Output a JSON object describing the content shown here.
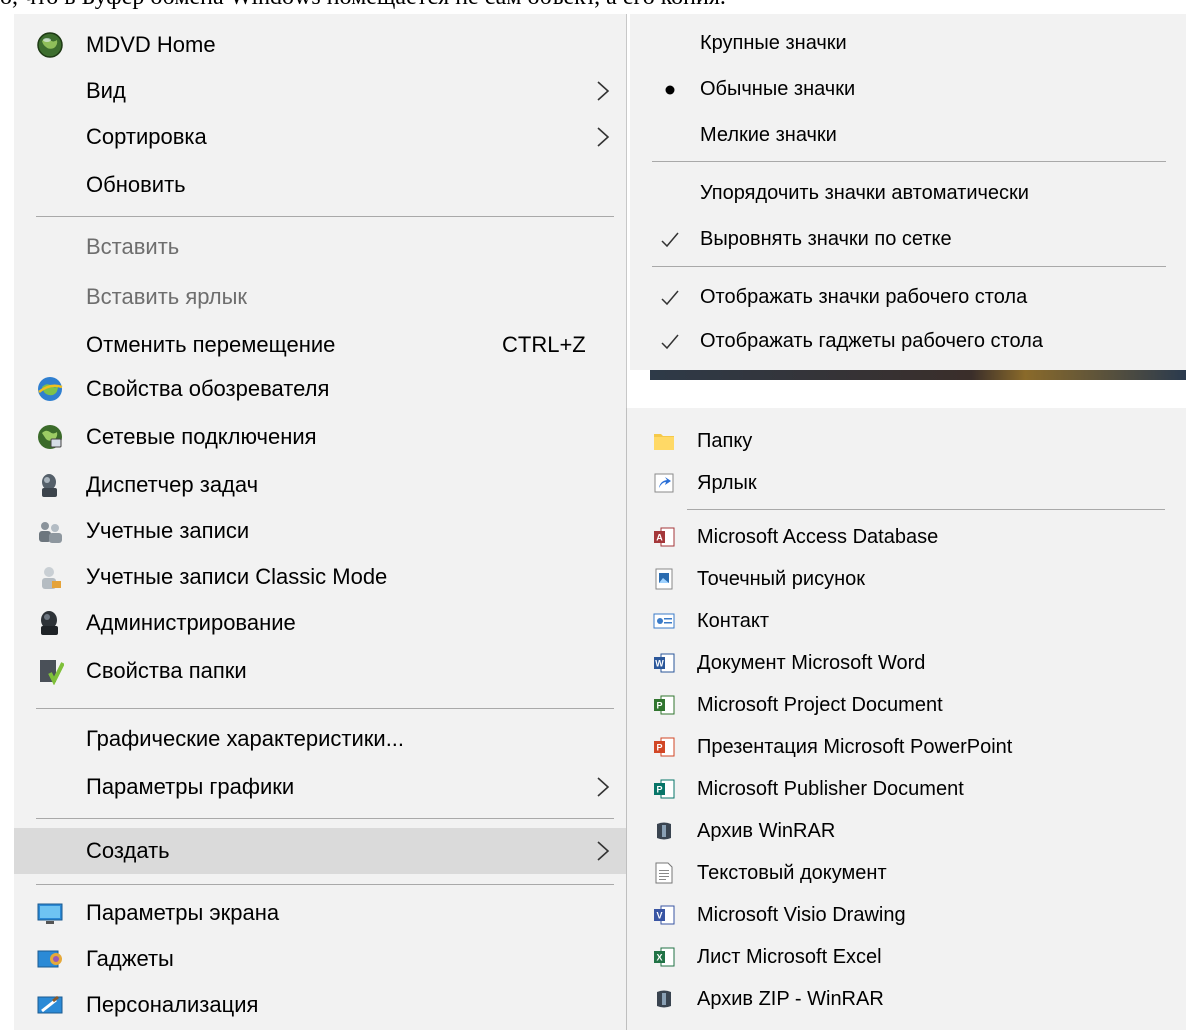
{
  "document": {
    "header_text": "о, что в Буфер обмена Windows помещается не сам объект, а его копия."
  },
  "main_menu": {
    "items": [
      {
        "label": "MDVD Home",
        "icon": "globe-icon"
      },
      {
        "label": "Вид",
        "submenu": true
      },
      {
        "label": "Сортировка",
        "submenu": true
      },
      {
        "label": "Обновить"
      },
      {
        "label": "Вставить",
        "disabled": true
      },
      {
        "label": "Вставить ярлык",
        "disabled": true
      },
      {
        "label": "Отменить перемещение",
        "shortcut": "CTRL+Z"
      },
      {
        "label": "Свойства обозревателя",
        "icon": "internet-options-icon"
      },
      {
        "label": "Сетевые подключения",
        "icon": "network-connections-icon"
      },
      {
        "label": "Диспетчер задач",
        "icon": "task-manager-icon"
      },
      {
        "label": "Учетные записи",
        "icon": "user-accounts-icon"
      },
      {
        "label": "Учетные записи Classic Mode",
        "icon": "user-accounts-classic-icon"
      },
      {
        "label": "Администрирование",
        "icon": "administration-icon"
      },
      {
        "label": "Свойства папки",
        "icon": "folder-options-icon"
      },
      {
        "label": "Графические характеристики..."
      },
      {
        "label": "Параметры графики",
        "submenu": true
      },
      {
        "label": "Создать",
        "submenu": true,
        "highlighted": true
      },
      {
        "label": "Параметры экрана",
        "icon": "display-settings-icon"
      },
      {
        "label": "Гаджеты",
        "icon": "gadgets-icon"
      },
      {
        "label": "Персонализация",
        "icon": "personalization-icon"
      }
    ]
  },
  "view_menu": {
    "items": [
      {
        "label": "Крупные значки"
      },
      {
        "label": "Обычные значки",
        "mark": "bullet"
      },
      {
        "label": "Мелкие значки"
      },
      {
        "label": "Упорядочить значки автоматически"
      },
      {
        "label": "Выровнять значки по сетке",
        "mark": "check"
      },
      {
        "label": "Отображать значки рабочего стола",
        "mark": "check"
      },
      {
        "label": "Отображать гаджеты  рабочего стола",
        "mark": "check"
      }
    ]
  },
  "new_menu": {
    "items": [
      {
        "label": "Папку",
        "icon": "folder-icon"
      },
      {
        "label": "Ярлык",
        "icon": "shortcut-icon"
      },
      {
        "label": "Microsoft Access Database",
        "icon": "access-icon",
        "color": "#a4373a"
      },
      {
        "label": "Точечный рисунок",
        "icon": "bitmap-icon",
        "color": "#2b6cb0"
      },
      {
        "label": "Контакт",
        "icon": "contact-icon",
        "color": "#3a7bc8"
      },
      {
        "label": "Документ Microsoft Word",
        "icon": "word-icon",
        "color": "#2b579a"
      },
      {
        "label": "Microsoft Project Document",
        "icon": "project-icon",
        "color": "#31752f"
      },
      {
        "label": "Презентация Microsoft PowerPoint",
        "icon": "powerpoint-icon",
        "color": "#d24726"
      },
      {
        "label": "Microsoft Publisher Document",
        "icon": "publisher-icon",
        "color": "#077568"
      },
      {
        "label": "Архив WinRAR",
        "icon": "winrar-icon",
        "color": "#3a4450"
      },
      {
        "label": "Текстовый документ",
        "icon": "text-document-icon"
      },
      {
        "label": "Microsoft Visio Drawing",
        "icon": "visio-icon",
        "color": "#3955a3"
      },
      {
        "label": "Лист Microsoft Excel",
        "icon": "excel-icon",
        "color": "#217346"
      },
      {
        "label": "Архив ZIP - WinRAR",
        "icon": "zip-winrar-icon",
        "color": "#3a4450"
      }
    ]
  }
}
